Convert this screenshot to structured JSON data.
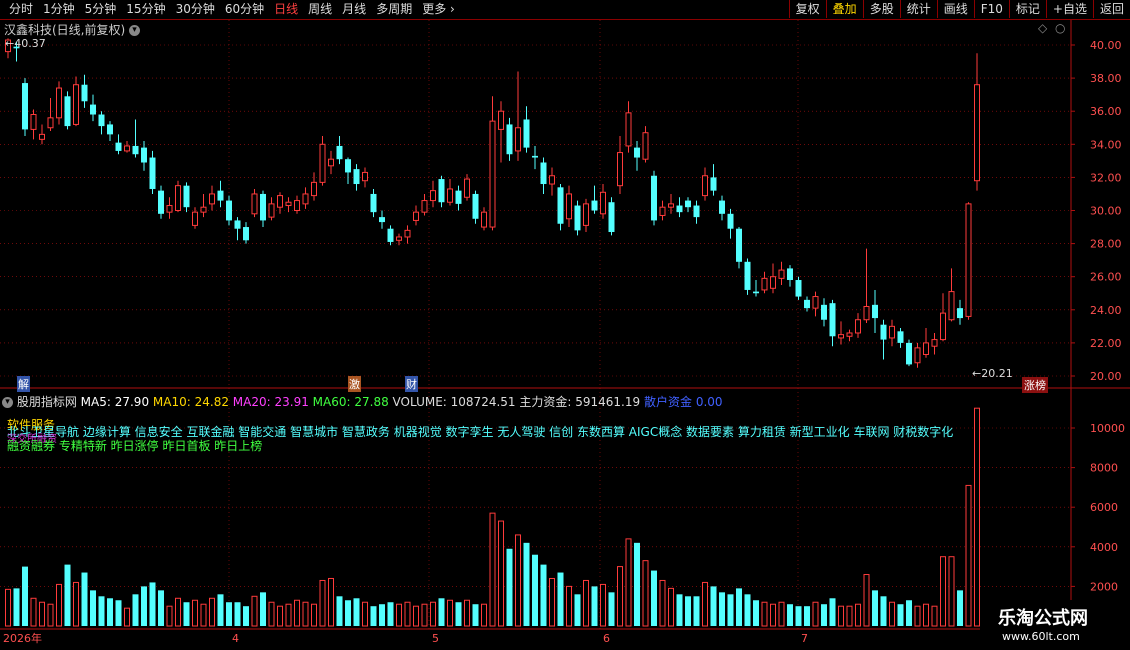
{
  "toolbar": {
    "left": [
      "分时",
      "1分钟",
      "5分钟",
      "15分钟",
      "30分钟",
      "60分钟",
      "日线",
      "周线",
      "月线",
      "多周期",
      "更多"
    ],
    "active_left": "日线",
    "right": [
      "复权",
      "叠加",
      "多股",
      "统计",
      "画线",
      "F10",
      "标记",
      "+自选",
      "返回"
    ],
    "active_right": "叠加"
  },
  "stock": {
    "title": "汉鑫科技(日线,前复权)",
    "high_label": "40.37",
    "low_label": "20.21",
    "zhangbang": "涨榜",
    "markers": [
      "解",
      "激",
      "财"
    ]
  },
  "price_axis": [
    "40.00",
    "38.00",
    "36.00",
    "34.00",
    "32.00",
    "30.00",
    "28.00",
    "26.00",
    "24.00",
    "22.00",
    "20.00"
  ],
  "volume_axis": [
    "10000",
    "8000",
    "6000",
    "4000",
    "2000"
  ],
  "date_axis": [
    "2026年",
    "4",
    "5",
    "6",
    "7"
  ],
  "indicator": {
    "name": "股朋指标网",
    "ma5": "MA5: 27.90",
    "ma10": "MA10: 24.82",
    "ma20": "MA20: 23.91",
    "ma60": "MA60: 27.88",
    "volume": "VOLUME: 108724.51",
    "main_fund": "主力资金: 591461.19",
    "retail_label": "散户资金",
    "retail_value": "0.00"
  },
  "concepts": {
    "line1_label": "软件服务",
    "line2": "北斗卫星导航 边缘计算 信息安全 互联金融 智能交通 智慧城市 智慧政务 机器视觉 数字孪生 无人驾驶 信创 东数西算 AIGC概念 数据要素 算力租赁 新型工业化 车联网 财税数字化",
    "line2_overlay": "深交所融资",
    "line3": "融资融券 专精特新 昨日涨停 昨日首板 昨日上榜"
  },
  "watermark": {
    "main": "乐淘公式网",
    "sub": "www.60lt.com"
  },
  "colors": {
    "up": "#ff3b3b",
    "down": "#54ffff",
    "axis": "#b01010",
    "ma5": "#ffffff",
    "ma10": "#ffd700",
    "ma20": "#ff40ff",
    "ma60": "#40ff40",
    "retail": "#4060ff"
  },
  "chart_data": {
    "type": "candlestick",
    "price_range": [
      19.5,
      41.0
    ],
    "volume_range": [
      0,
      11600
    ],
    "candles": [
      {
        "o": 39.6,
        "c": 40.3,
        "h": 40.4,
        "l": 39.2,
        "v": 1850
      },
      {
        "o": 39.9,
        "c": 39.8,
        "h": 40.2,
        "l": 39.0,
        "v": 1900
      },
      {
        "o": 37.7,
        "c": 34.9,
        "h": 38.0,
        "l": 34.5,
        "v": 3000
      },
      {
        "o": 34.9,
        "c": 35.8,
        "h": 36.1,
        "l": 34.3,
        "v": 1400
      },
      {
        "o": 34.3,
        "c": 34.6,
        "h": 35.2,
        "l": 34.0,
        "v": 1200
      },
      {
        "o": 35.0,
        "c": 35.6,
        "h": 36.8,
        "l": 34.8,
        "v": 1100
      },
      {
        "o": 35.6,
        "c": 37.4,
        "h": 37.8,
        "l": 35.2,
        "v": 2100
      },
      {
        "o": 36.9,
        "c": 35.1,
        "h": 37.2,
        "l": 34.9,
        "v": 3100
      },
      {
        "o": 35.2,
        "c": 37.6,
        "h": 38.1,
        "l": 35.1,
        "v": 2200
      },
      {
        "o": 37.6,
        "c": 36.6,
        "h": 38.2,
        "l": 36.2,
        "v": 2700
      },
      {
        "o": 36.4,
        "c": 35.8,
        "h": 37.0,
        "l": 35.4,
        "v": 1800
      },
      {
        "o": 35.8,
        "c": 35.1,
        "h": 36.0,
        "l": 34.6,
        "v": 1500
      },
      {
        "o": 35.2,
        "c": 34.6,
        "h": 35.4,
        "l": 34.2,
        "v": 1400
      },
      {
        "o": 34.1,
        "c": 33.6,
        "h": 34.6,
        "l": 33.4,
        "v": 1300
      },
      {
        "o": 33.6,
        "c": 33.9,
        "h": 34.2,
        "l": 33.5,
        "v": 900
      },
      {
        "o": 33.9,
        "c": 33.4,
        "h": 35.5,
        "l": 33.2,
        "v": 1600
      },
      {
        "o": 33.8,
        "c": 32.9,
        "h": 34.2,
        "l": 32.4,
        "v": 2000
      },
      {
        "o": 33.2,
        "c": 31.3,
        "h": 33.6,
        "l": 31.0,
        "v": 2200
      },
      {
        "o": 31.2,
        "c": 29.8,
        "h": 31.5,
        "l": 29.5,
        "v": 1800
      },
      {
        "o": 29.9,
        "c": 30.3,
        "h": 30.8,
        "l": 29.5,
        "v": 1000
      },
      {
        "o": 30.0,
        "c": 31.5,
        "h": 31.8,
        "l": 29.9,
        "v": 1400
      },
      {
        "o": 31.5,
        "c": 30.2,
        "h": 31.7,
        "l": 29.9,
        "v": 1200
      },
      {
        "o": 29.1,
        "c": 29.9,
        "h": 30.2,
        "l": 28.9,
        "v": 1300
      },
      {
        "o": 29.9,
        "c": 30.2,
        "h": 31.0,
        "l": 29.6,
        "v": 1100
      },
      {
        "o": 30.4,
        "c": 31.0,
        "h": 31.5,
        "l": 30.0,
        "v": 1400
      },
      {
        "o": 31.2,
        "c": 30.6,
        "h": 31.8,
        "l": 30.2,
        "v": 1600
      },
      {
        "o": 30.6,
        "c": 29.4,
        "h": 30.9,
        "l": 29.1,
        "v": 1200
      },
      {
        "o": 29.4,
        "c": 28.9,
        "h": 29.6,
        "l": 28.2,
        "v": 1200
      },
      {
        "o": 29.0,
        "c": 28.2,
        "h": 29.3,
        "l": 28.0,
        "v": 1000
      },
      {
        "o": 29.8,
        "c": 31.0,
        "h": 31.3,
        "l": 29.6,
        "v": 1500
      },
      {
        "o": 31.0,
        "c": 29.4,
        "h": 31.2,
        "l": 29.0,
        "v": 1700
      },
      {
        "o": 29.6,
        "c": 30.4,
        "h": 30.8,
        "l": 29.4,
        "v": 1200
      },
      {
        "o": 30.2,
        "c": 30.9,
        "h": 31.1,
        "l": 29.8,
        "v": 1000
      },
      {
        "o": 30.3,
        "c": 30.5,
        "h": 30.8,
        "l": 29.9,
        "v": 1100
      },
      {
        "o": 30.0,
        "c": 30.6,
        "h": 30.9,
        "l": 29.8,
        "v": 1300
      },
      {
        "o": 30.4,
        "c": 31.0,
        "h": 31.4,
        "l": 30.1,
        "v": 1200
      },
      {
        "o": 30.9,
        "c": 31.7,
        "h": 32.3,
        "l": 30.6,
        "v": 1100
      },
      {
        "o": 31.7,
        "c": 34.0,
        "h": 34.5,
        "l": 31.5,
        "v": 2300
      },
      {
        "o": 32.7,
        "c": 33.1,
        "h": 33.6,
        "l": 32.2,
        "v": 2400
      },
      {
        "o": 33.9,
        "c": 33.1,
        "h": 34.5,
        "l": 32.8,
        "v": 1500
      },
      {
        "o": 33.1,
        "c": 32.3,
        "h": 33.2,
        "l": 31.6,
        "v": 1300
      },
      {
        "o": 32.5,
        "c": 31.6,
        "h": 32.8,
        "l": 31.2,
        "v": 1400
      },
      {
        "o": 31.8,
        "c": 32.3,
        "h": 32.6,
        "l": 31.4,
        "v": 1200
      },
      {
        "o": 31.0,
        "c": 29.9,
        "h": 31.3,
        "l": 29.6,
        "v": 1000
      },
      {
        "o": 29.6,
        "c": 29.3,
        "h": 30.0,
        "l": 28.9,
        "v": 1100
      },
      {
        "o": 28.9,
        "c": 28.1,
        "h": 29.1,
        "l": 27.9,
        "v": 1200
      },
      {
        "o": 28.2,
        "c": 28.4,
        "h": 28.6,
        "l": 27.9,
        "v": 1100
      },
      {
        "o": 28.4,
        "c": 28.8,
        "h": 29.1,
        "l": 28.0,
        "v": 1200
      },
      {
        "o": 29.4,
        "c": 29.9,
        "h": 30.3,
        "l": 29.1,
        "v": 1000
      },
      {
        "o": 29.9,
        "c": 30.6,
        "h": 31.0,
        "l": 29.7,
        "v": 1100
      },
      {
        "o": 30.6,
        "c": 31.2,
        "h": 31.8,
        "l": 30.2,
        "v": 1200
      },
      {
        "o": 31.9,
        "c": 30.5,
        "h": 32.1,
        "l": 30.2,
        "v": 1400
      },
      {
        "o": 30.5,
        "c": 31.3,
        "h": 31.9,
        "l": 30.3,
        "v": 1300
      },
      {
        "o": 31.2,
        "c": 30.4,
        "h": 31.5,
        "l": 30.0,
        "v": 1200
      },
      {
        "o": 30.8,
        "c": 31.9,
        "h": 32.2,
        "l": 30.6,
        "v": 1300
      },
      {
        "o": 31.0,
        "c": 29.5,
        "h": 31.2,
        "l": 29.2,
        "v": 1100
      },
      {
        "o": 29.0,
        "c": 29.9,
        "h": 30.2,
        "l": 28.8,
        "v": 1100
      },
      {
        "o": 29.0,
        "c": 35.4,
        "h": 36.9,
        "l": 28.8,
        "v": 5700
      },
      {
        "o": 34.9,
        "c": 36.0,
        "h": 36.6,
        "l": 32.9,
        "v": 5300
      },
      {
        "o": 35.2,
        "c": 33.4,
        "h": 35.6,
        "l": 33.0,
        "v": 3900
      },
      {
        "o": 33.6,
        "c": 35.0,
        "h": 38.4,
        "l": 33.0,
        "v": 4600
      },
      {
        "o": 35.5,
        "c": 33.8,
        "h": 36.3,
        "l": 33.5,
        "v": 4200
      },
      {
        "o": 33.3,
        "c": 33.2,
        "h": 33.9,
        "l": 32.5,
        "v": 3600
      },
      {
        "o": 32.9,
        "c": 31.6,
        "h": 33.2,
        "l": 31.0,
        "v": 3100
      },
      {
        "o": 31.6,
        "c": 32.1,
        "h": 32.6,
        "l": 30.9,
        "v": 2400
      },
      {
        "o": 31.4,
        "c": 29.2,
        "h": 31.6,
        "l": 28.8,
        "v": 2700
      },
      {
        "o": 29.5,
        "c": 31.0,
        "h": 31.5,
        "l": 29.0,
        "v": 2000
      },
      {
        "o": 30.3,
        "c": 28.8,
        "h": 30.6,
        "l": 28.5,
        "v": 1600
      },
      {
        "o": 29.1,
        "c": 30.4,
        "h": 30.7,
        "l": 28.7,
        "v": 2300
      },
      {
        "o": 30.6,
        "c": 30.0,
        "h": 31.5,
        "l": 29.8,
        "v": 2000
      },
      {
        "o": 29.8,
        "c": 31.1,
        "h": 31.6,
        "l": 29.5,
        "v": 2100
      },
      {
        "o": 30.5,
        "c": 28.7,
        "h": 30.8,
        "l": 28.5,
        "v": 1700
      },
      {
        "o": 31.5,
        "c": 33.5,
        "h": 34.5,
        "l": 31.0,
        "v": 3000
      },
      {
        "o": 33.9,
        "c": 35.9,
        "h": 36.6,
        "l": 33.5,
        "v": 4400
      },
      {
        "o": 33.8,
        "c": 33.2,
        "h": 34.2,
        "l": 32.4,
        "v": 4200
      },
      {
        "o": 33.1,
        "c": 34.7,
        "h": 35.1,
        "l": 32.9,
        "v": 3300
      },
      {
        "o": 32.1,
        "c": 29.4,
        "h": 32.4,
        "l": 29.1,
        "v": 2800
      },
      {
        "o": 29.7,
        "c": 30.2,
        "h": 30.6,
        "l": 29.4,
        "v": 2300
      },
      {
        "o": 30.2,
        "c": 30.4,
        "h": 31.0,
        "l": 29.8,
        "v": 1900
      },
      {
        "o": 30.3,
        "c": 29.9,
        "h": 30.8,
        "l": 29.6,
        "v": 1600
      },
      {
        "o": 30.6,
        "c": 30.2,
        "h": 30.8,
        "l": 29.9,
        "v": 1500
      },
      {
        "o": 30.3,
        "c": 29.6,
        "h": 30.6,
        "l": 29.2,
        "v": 1500
      },
      {
        "o": 30.9,
        "c": 32.1,
        "h": 32.6,
        "l": 30.6,
        "v": 2200
      },
      {
        "o": 32.0,
        "c": 31.2,
        "h": 32.8,
        "l": 30.9,
        "v": 2000
      },
      {
        "o": 30.6,
        "c": 29.8,
        "h": 30.9,
        "l": 29.4,
        "v": 1700
      },
      {
        "o": 29.8,
        "c": 28.9,
        "h": 30.1,
        "l": 28.3,
        "v": 1600
      },
      {
        "o": 28.9,
        "c": 26.9,
        "h": 29.0,
        "l": 26.5,
        "v": 1900
      },
      {
        "o": 26.9,
        "c": 25.2,
        "h": 27.1,
        "l": 24.9,
        "v": 1600
      },
      {
        "o": 25.1,
        "c": 25.0,
        "h": 25.8,
        "l": 24.8,
        "v": 1300
      },
      {
        "o": 25.2,
        "c": 25.9,
        "h": 26.3,
        "l": 25.0,
        "v": 1200
      },
      {
        "o": 25.3,
        "c": 26.0,
        "h": 26.8,
        "l": 25.0,
        "v": 1100
      },
      {
        "o": 25.9,
        "c": 26.4,
        "h": 26.9,
        "l": 25.5,
        "v": 1200
      },
      {
        "o": 26.5,
        "c": 25.8,
        "h": 26.7,
        "l": 25.4,
        "v": 1100
      },
      {
        "o": 25.8,
        "c": 24.8,
        "h": 26.0,
        "l": 24.6,
        "v": 1000
      },
      {
        "o": 24.6,
        "c": 24.1,
        "h": 24.8,
        "l": 23.9,
        "v": 1000
      },
      {
        "o": 24.1,
        "c": 24.8,
        "h": 25.1,
        "l": 23.6,
        "v": 1200
      },
      {
        "o": 24.3,
        "c": 23.4,
        "h": 24.7,
        "l": 23.0,
        "v": 1100
      },
      {
        "o": 24.4,
        "c": 22.4,
        "h": 24.6,
        "l": 21.8,
        "v": 1400
      },
      {
        "o": 22.3,
        "c": 22.5,
        "h": 23.3,
        "l": 21.9,
        "v": 1000
      },
      {
        "o": 22.4,
        "c": 22.6,
        "h": 22.8,
        "l": 22.1,
        "v": 1000
      },
      {
        "o": 22.6,
        "c": 23.4,
        "h": 23.8,
        "l": 22.3,
        "v": 1100
      },
      {
        "o": 23.4,
        "c": 24.2,
        "h": 27.7,
        "l": 23.2,
        "v": 2600
      },
      {
        "o": 24.3,
        "c": 23.5,
        "h": 25.2,
        "l": 22.6,
        "v": 1800
      },
      {
        "o": 23.1,
        "c": 22.2,
        "h": 23.4,
        "l": 21.0,
        "v": 1500
      },
      {
        "o": 22.3,
        "c": 23.0,
        "h": 23.4,
        "l": 21.8,
        "v": 1200
      },
      {
        "o": 22.7,
        "c": 22.0,
        "h": 22.9,
        "l": 21.7,
        "v": 1100
      },
      {
        "o": 22.0,
        "c": 20.7,
        "h": 22.2,
        "l": 20.6,
        "v": 1300
      },
      {
        "o": 20.8,
        "c": 21.7,
        "h": 22.0,
        "l": 20.5,
        "v": 1000
      },
      {
        "o": 21.3,
        "c": 22.0,
        "h": 22.9,
        "l": 21.1,
        "v": 1100
      },
      {
        "o": 21.8,
        "c": 22.2,
        "h": 22.6,
        "l": 21.3,
        "v": 1000
      },
      {
        "o": 22.2,
        "c": 23.8,
        "h": 25.0,
        "l": 22.1,
        "v": 3500
      },
      {
        "o": 23.4,
        "c": 25.1,
        "h": 26.5,
        "l": 23.3,
        "v": 3500
      },
      {
        "o": 24.1,
        "c": 23.5,
        "h": 24.6,
        "l": 23.1,
        "v": 1800
      },
      {
        "o": 23.6,
        "c": 30.4,
        "h": 30.5,
        "l": 23.4,
        "v": 7100
      },
      {
        "o": 31.8,
        "c": 37.6,
        "h": 39.5,
        "l": 31.2,
        "v": 11000
      }
    ]
  }
}
